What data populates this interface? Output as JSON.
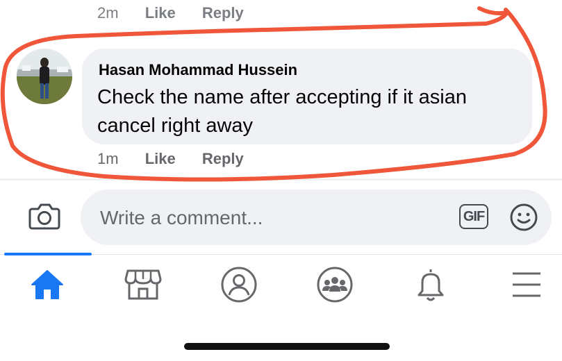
{
  "previous_comment": {
    "time": "2m",
    "like_label": "Like",
    "reply_label": "Reply"
  },
  "comment": {
    "author": "Hasan Mohammad Hussein",
    "text": "Check the name after accepting if it asian cancel right away",
    "time": "1m",
    "like_label": "Like",
    "reply_label": "Reply"
  },
  "composer": {
    "placeholder": "Write a comment...",
    "gif_label": "GIF"
  },
  "bottom_nav": {
    "items": [
      {
        "icon": "home-icon",
        "active": true
      },
      {
        "icon": "marketplace-icon",
        "active": false
      },
      {
        "icon": "profile-icon",
        "active": false
      },
      {
        "icon": "groups-icon",
        "active": false
      },
      {
        "icon": "notifications-icon",
        "active": false
      },
      {
        "icon": "menu-icon",
        "active": false
      }
    ]
  },
  "colors": {
    "accent": "#1877f2",
    "annotation": "#f0573a",
    "bubble": "#eff1f4"
  }
}
